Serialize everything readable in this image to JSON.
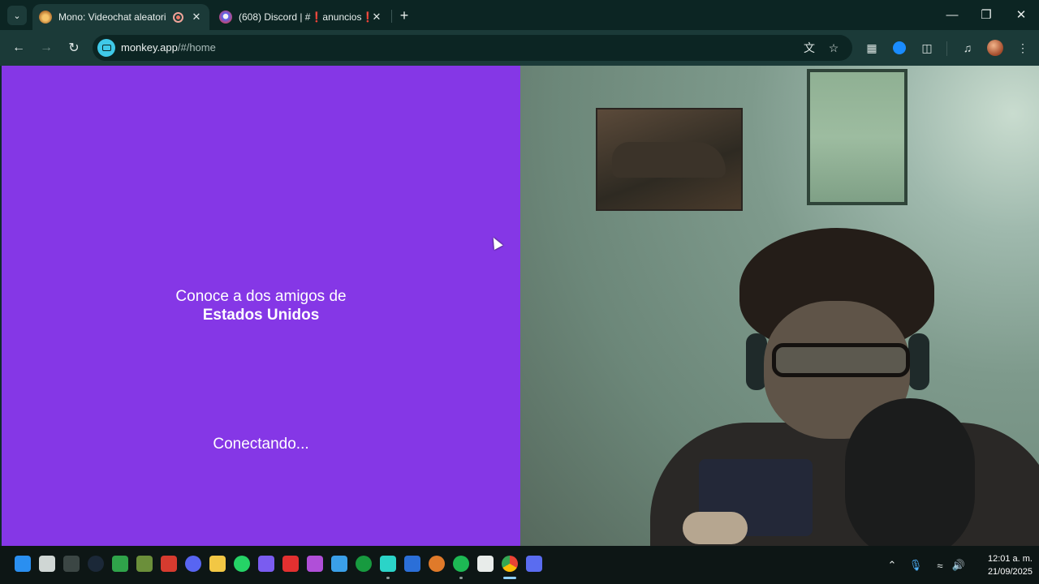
{
  "browser": {
    "tabs": [
      {
        "title": "Mono: Videochat aleatorio",
        "active": true,
        "favicon": "monkey-favicon"
      },
      {
        "title": "(608) Discord | #❗anuncios❗",
        "active": false,
        "favicon": "discord-favicon"
      }
    ],
    "new_tab_label": "+",
    "window_controls": {
      "minimize": "—",
      "maximize": "❐",
      "close": "✕"
    },
    "url": {
      "host": "monkey.app",
      "path": "/#/home"
    }
  },
  "page": {
    "intro_line": "Conoce a dos amigos de",
    "country": "Estados Unidos",
    "status": "Conectando...",
    "panel_color": "#8537e6"
  },
  "taskbar": {
    "apps": [
      "windows-start-icon",
      "task-view-icon",
      "widgets-icon",
      "steam-icon",
      "xbox-app-icon",
      "minecraft-icon",
      "game-launcher-icon",
      "discord-icon",
      "file-explorer-icon",
      "whatsapp-icon",
      "vpn-icon",
      "wps-icon",
      "video-editor-icon",
      "photos-icon",
      "xbox-icon",
      "capcut-icon",
      "xmind-icon",
      "browser-icon",
      "spotify-icon",
      "calculator-icon",
      "chrome-icon",
      "screen-recorder-icon"
    ],
    "clock": {
      "time": "12:01 a. m.",
      "date": "21/09/2025"
    }
  }
}
